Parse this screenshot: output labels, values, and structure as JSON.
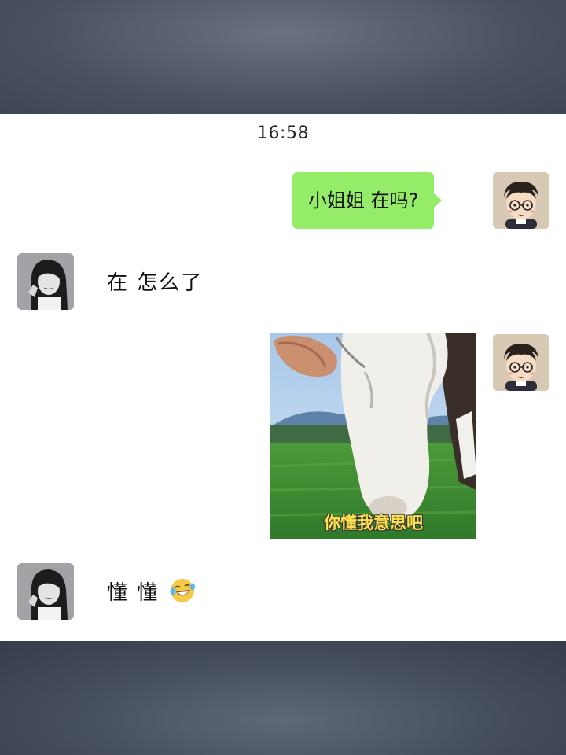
{
  "chat": {
    "timestamp": "16:58",
    "messages": [
      {
        "sender": "me",
        "type": "text",
        "text": "小姐姐 在吗?"
      },
      {
        "sender": "other",
        "type": "text",
        "text": "在 怎么了"
      },
      {
        "sender": "me",
        "type": "sticker",
        "caption": "你懂我意思吧"
      },
      {
        "sender": "other",
        "type": "text",
        "text": "懂 懂",
        "emoji": "laughing-crying-emoji"
      }
    ],
    "avatars": {
      "me": "cartoon-boy-avatar",
      "other": "girl-photo-avatar"
    }
  },
  "colors": {
    "bubble_green": "#95ec69",
    "caption_yellow": "#ffe14d"
  }
}
